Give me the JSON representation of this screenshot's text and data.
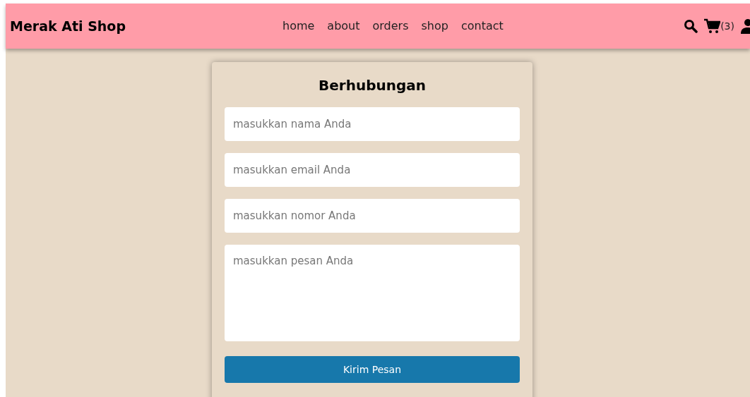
{
  "header": {
    "brand": "Merak Ati Shop",
    "nav": [
      "home",
      "about",
      "orders",
      "shop",
      "contact"
    ],
    "cart_count": "(3)"
  },
  "contact_form": {
    "title": "Berhubungan",
    "fields": [
      {
        "kind": "input",
        "placeholder": "masukkan nama Anda"
      },
      {
        "kind": "input",
        "placeholder": "masukkan email Anda"
      },
      {
        "kind": "input",
        "placeholder": "masukkan nomor Anda"
      },
      {
        "kind": "textarea",
        "placeholder": "masukkan pesan Anda"
      }
    ],
    "submit": "Kirim Pesan"
  }
}
